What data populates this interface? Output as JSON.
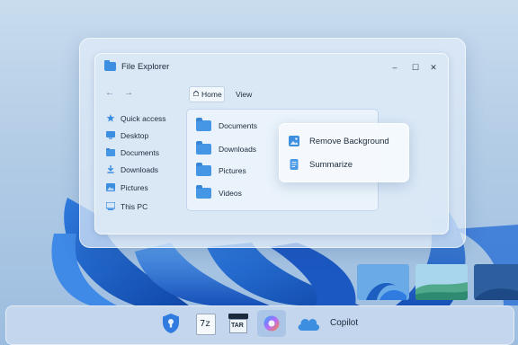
{
  "window": {
    "title": "File Explorer",
    "controls": {
      "minimize": "–",
      "maximize": "☐",
      "close": "✕"
    }
  },
  "nav": {
    "back": "←",
    "forward": "→"
  },
  "tabs": {
    "home": "Home",
    "view": "View"
  },
  "sidebar": {
    "items": [
      {
        "label": "Quick access",
        "icon": "star-icon"
      },
      {
        "label": "Desktop",
        "icon": "desktop-icon"
      },
      {
        "label": "Documents",
        "icon": "documents-icon"
      },
      {
        "label": "Downloads",
        "icon": "download-icon"
      },
      {
        "label": "Pictures",
        "icon": "pictures-icon"
      },
      {
        "label": "This PC",
        "icon": "pc-icon"
      }
    ]
  },
  "files": {
    "items": [
      {
        "label": "Documents",
        "icon": "folder-icon"
      },
      {
        "label": "Downloads",
        "icon": "folder-icon"
      },
      {
        "label": "Pictures",
        "icon": "folder-icon"
      },
      {
        "label": "Videos",
        "icon": "folder-icon"
      }
    ]
  },
  "context_menu": {
    "items": [
      {
        "label": "Remove Background",
        "icon": "image-icon"
      },
      {
        "label": "Summarize",
        "icon": "document-icon"
      }
    ]
  },
  "taskbar": {
    "items": [
      {
        "icon": "shield-lock-icon"
      },
      {
        "icon": "7zip-icon",
        "label": "7z"
      },
      {
        "icon": "tar-archive-icon",
        "label": "TAR"
      },
      {
        "icon": "copilot-icon"
      },
      {
        "icon": "cloud-icon"
      }
    ],
    "copilot_label": "Copilot"
  },
  "colors": {
    "accent": "#3c8ee0",
    "folder": "#4596e4",
    "wallpaper": "#1e5fbf"
  }
}
